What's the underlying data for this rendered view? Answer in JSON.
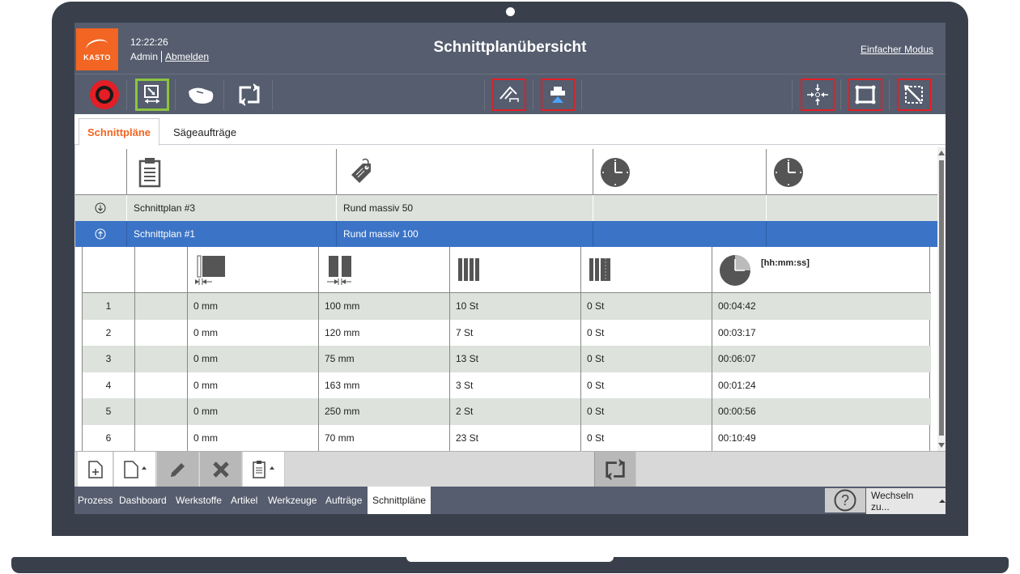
{
  "header": {
    "logo_text": "KASTO",
    "time": "12:22:26",
    "user": "Admin",
    "logout_label": "Abmelden",
    "title": "Schnittplanübersicht",
    "mode_link": "Einfacher Modus"
  },
  "tabs": [
    {
      "label": "Schnittpläne",
      "active": true
    },
    {
      "label": "Sägeaufträge",
      "active": false
    }
  ],
  "outer_table": {
    "header_icons": [
      "clipboard-icon",
      "tag-icon",
      "clock-icon",
      "clock-icon"
    ],
    "rows": [
      {
        "expand_icon": "expand-down-icon",
        "plan": "Schnittplan #3",
        "material": "Rund massiv 50",
        "selected": false
      },
      {
        "expand_icon": "collapse-up-icon",
        "plan": "Schnittplan #1",
        "material": "Rund massiv 100",
        "selected": true
      }
    ]
  },
  "inner_table": {
    "time_unit_label": "[hh:mm:ss]",
    "header_icons": [
      "left-offset-icon",
      "cut-length-icon",
      "pieces-icon",
      "remaining-pieces-icon",
      "time-icon"
    ],
    "rows": [
      {
        "index": "1",
        "offset": "0 mm",
        "length": "100 mm",
        "pieces": "10 St",
        "rest": "0 St",
        "time": "00:04:42"
      },
      {
        "index": "2",
        "offset": "0 mm",
        "length": "120 mm",
        "pieces": "7 St",
        "rest": "0 St",
        "time": "00:03:17"
      },
      {
        "index": "3",
        "offset": "0 mm",
        "length": "75 mm",
        "pieces": "13 St",
        "rest": "0 St",
        "time": "00:06:07"
      },
      {
        "index": "4",
        "offset": "0 mm",
        "length": "163 mm",
        "pieces": "3 St",
        "rest": "0 St",
        "time": "00:01:24"
      },
      {
        "index": "5",
        "offset": "0 mm",
        "length": "250 mm",
        "pieces": "2 St",
        "rest": "0 St",
        "time": "00:00:56"
      },
      {
        "index": "6",
        "offset": "0 mm",
        "length": "70 mm",
        "pieces": "23 St",
        "rest": "0 St",
        "time": "00:10:49"
      }
    ]
  },
  "nav": {
    "items": [
      "Prozess",
      "Dashboard",
      "Werkstoffe",
      "Artikel",
      "Werkzeuge",
      "Aufträge",
      "Schnittpläne"
    ],
    "active": "Schnittpläne",
    "switch_label": "Wechseln zu..."
  },
  "colors": {
    "header_bg": "#555d6e",
    "accent_orange": "#f26522",
    "selected_row": "#3b73c6",
    "alt_row": "#dde2dd",
    "highlight_red": "#e31e24",
    "highlight_green": "#8bc540"
  }
}
